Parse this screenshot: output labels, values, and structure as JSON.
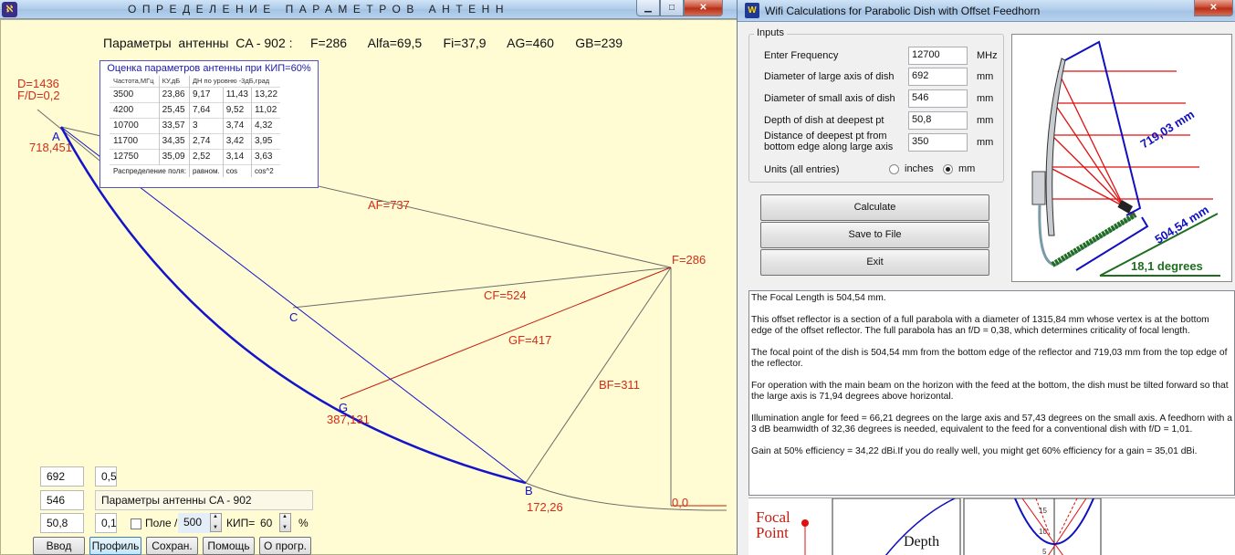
{
  "left_window": {
    "title": "ОПРЕДЕЛЕНИЕ ПАРАМЕТРОВ АНТЕНН",
    "icon": "app-logo-icon",
    "header": "Параметры  антенны  CA - 902 :     F=286      Alfa=69,5      Fi=37,9      AG=460      GB=239",
    "kip": {
      "title": "Оценка параметров антенны при КИП=60%",
      "col_freq": "Частота,МГц",
      "col_gain": "КУ,дБ",
      "col_dn": "ДН по уровню -3дБ,град",
      "rows": [
        [
          "3500",
          "23,86",
          "9,17",
          "11,43",
          "13,22"
        ],
        [
          "4200",
          "25,45",
          "7,64",
          "9,52",
          "11,02"
        ],
        [
          "10700",
          "33,57",
          "3",
          "3,74",
          "4,32"
        ],
        [
          "11700",
          "34,35",
          "2,74",
          "3,42",
          "3,95"
        ],
        [
          "12750",
          "35,09",
          "2,52",
          "3,14",
          "3,63"
        ]
      ],
      "dist_label": "Распределение поля:",
      "dist_values": [
        "равном.",
        "cos",
        "cos^2"
      ]
    },
    "diagram": {
      "d_label": "D=1436",
      "fd_label": "F/D=0,2",
      "a_label": "A",
      "a_coords": "718,451",
      "af_label": "AF=737",
      "f_label": "F=286",
      "c_label": "C",
      "cf_label": "CF=524",
      "gf_label": "GF=417",
      "bf_label": "BF=311",
      "g_label": "G",
      "g_coords": "387,131",
      "b_label": "B",
      "b_coords": "172,26",
      "origin_label": "0,0"
    },
    "controls": {
      "field1": "692",
      "field2": "0,5",
      "field3": "546",
      "field4": "Параметры  антенны  CA - 902",
      "field5": "50,8",
      "field6": "0,1",
      "pole_label": "Поле /",
      "pole_value": "500",
      "kip_label": "КИП=",
      "kip_value": "60",
      "percent": "%",
      "btn_input": "Ввод",
      "btn_profile": "Профиль",
      "btn_save": "Сохран.",
      "btn_help": "Помощь",
      "btn_about": "О прогр."
    },
    "colors": {
      "curve": "#1414c8",
      "red_lines": "#c41e0f",
      "gray_lines": "#6b6b6b"
    }
  },
  "right_window": {
    "title": "Wifi Calculations for Parabolic Dish with Offset Feedhorn",
    "icon": "wifi-dish-icon",
    "inputs": {
      "legend": "Inputs",
      "rows": [
        {
          "label": "Enter Frequency",
          "value": "12700",
          "unit": "MHz"
        },
        {
          "label": "Diameter of large axis of dish",
          "value": "692",
          "unit": "mm"
        },
        {
          "label": "Diameter of small axis of dish",
          "value": "546",
          "unit": "mm"
        },
        {
          "label": "Depth of dish at deepest pt",
          "value": "50,8",
          "unit": "mm"
        },
        {
          "label": "Distance of deepest pt from bottom edge along large axis",
          "value": "350",
          "unit": "mm"
        }
      ],
      "units_label": "Units (all entries)",
      "unit_inches": "inches",
      "unit_mm": "mm",
      "selected_unit": "mm"
    },
    "buttons": {
      "calculate": "Calculate",
      "save": "Save to File",
      "exit": "Exit"
    },
    "dish_diagram": {
      "top_length": "719,03 mm",
      "bottom_length": "504,54 mm",
      "tilt": "18,1 degrees"
    },
    "results": [
      "The Focal Length is 504,54 mm.",
      "This offset reflector is a section of a full parabola with a diameter of 1315,84 mm whose vertex is at the bottom edge of the offset reflector. The full parabola has an f/D = 0,38, which determines criticality of focal length.",
      "The focal point of the dish is 504,54 mm from the bottom edge of the reflector and 719,03 mm from the top edge of the reflector.",
      "For operation with the main beam on the horizon with the feed at the bottom, the dish must be tilted forward so that the large axis is 71,94 degrees above horizontal.",
      "Illumination angle for feed = 66,21 degrees on the large axis and 57,43 degrees on the small axis. A feedhorn with a 3 dB beamwidth of 32,36 degrees is needed, equivalent to the feed for a conventional dish with f/D = 1,01.",
      "Gain at 50% efficiency = 34,22 dBi.If you do really well, you might get 60% efficiency for a gain = 35,01 dBi."
    ],
    "bottom": {
      "focal": "Focal",
      "point": "Point",
      "depth": "Depth",
      "ticks": [
        "15",
        "10",
        "5"
      ]
    }
  }
}
